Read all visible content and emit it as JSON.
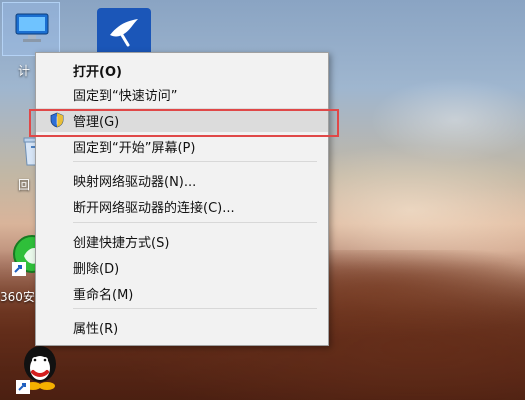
{
  "desktop": {
    "icons": [
      {
        "name": "computer-icon",
        "caption": "计"
      },
      {
        "name": "feishu-icon",
        "caption": ""
      },
      {
        "name": "recycle-bin-icon",
        "caption": "回"
      },
      {
        "name": "360-security-icon",
        "caption": "360安"
      },
      {
        "name": "qq-icon",
        "caption": ""
      }
    ]
  },
  "context_menu": {
    "items": [
      {
        "id": "open",
        "label": "打开(O)"
      },
      {
        "id": "pin-quick-access",
        "label": "固定到“快速访问”"
      },
      {
        "id": "manage",
        "label": "管理(G)"
      },
      {
        "id": "pin-start",
        "label": "固定到“开始”屏幕(P)"
      },
      {
        "id": "map-network-drive",
        "label": "映射网络驱动器(N)..."
      },
      {
        "id": "disconnect-network-drive",
        "label": "断开网络驱动器的连接(C)..."
      },
      {
        "id": "create-shortcut",
        "label": "创建快捷方式(S)"
      },
      {
        "id": "delete",
        "label": "删除(D)"
      },
      {
        "id": "rename",
        "label": "重命名(M)"
      },
      {
        "id": "properties",
        "label": "属性(R)"
      }
    ]
  },
  "colors": {
    "menu_bg": "#f2f2f2",
    "menu_border": "#a0a0a0",
    "highlight_red": "#e04848",
    "shield_blue": "#2f6fd6",
    "shield_yellow": "#f2c230"
  }
}
